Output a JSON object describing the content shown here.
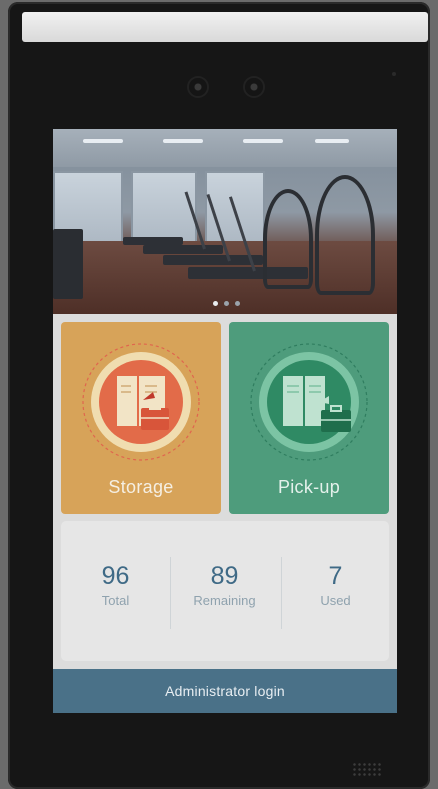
{
  "banner": {
    "slide_count": 3,
    "active_slide": 1
  },
  "tiles": {
    "storage": {
      "label": "Storage",
      "icon": "locker-store-icon",
      "color": "#d7a359"
    },
    "pickup": {
      "label": "Pick-up",
      "icon": "locker-pickup-icon",
      "color": "#4e9c7c"
    }
  },
  "stats": {
    "total": {
      "value": "96",
      "label": "Total"
    },
    "remaining": {
      "value": "89",
      "label": "Remaining"
    },
    "used": {
      "value": "7",
      "label": "Used"
    }
  },
  "footer": {
    "admin_label": "Administrator login",
    "color": "#4a7188"
  }
}
